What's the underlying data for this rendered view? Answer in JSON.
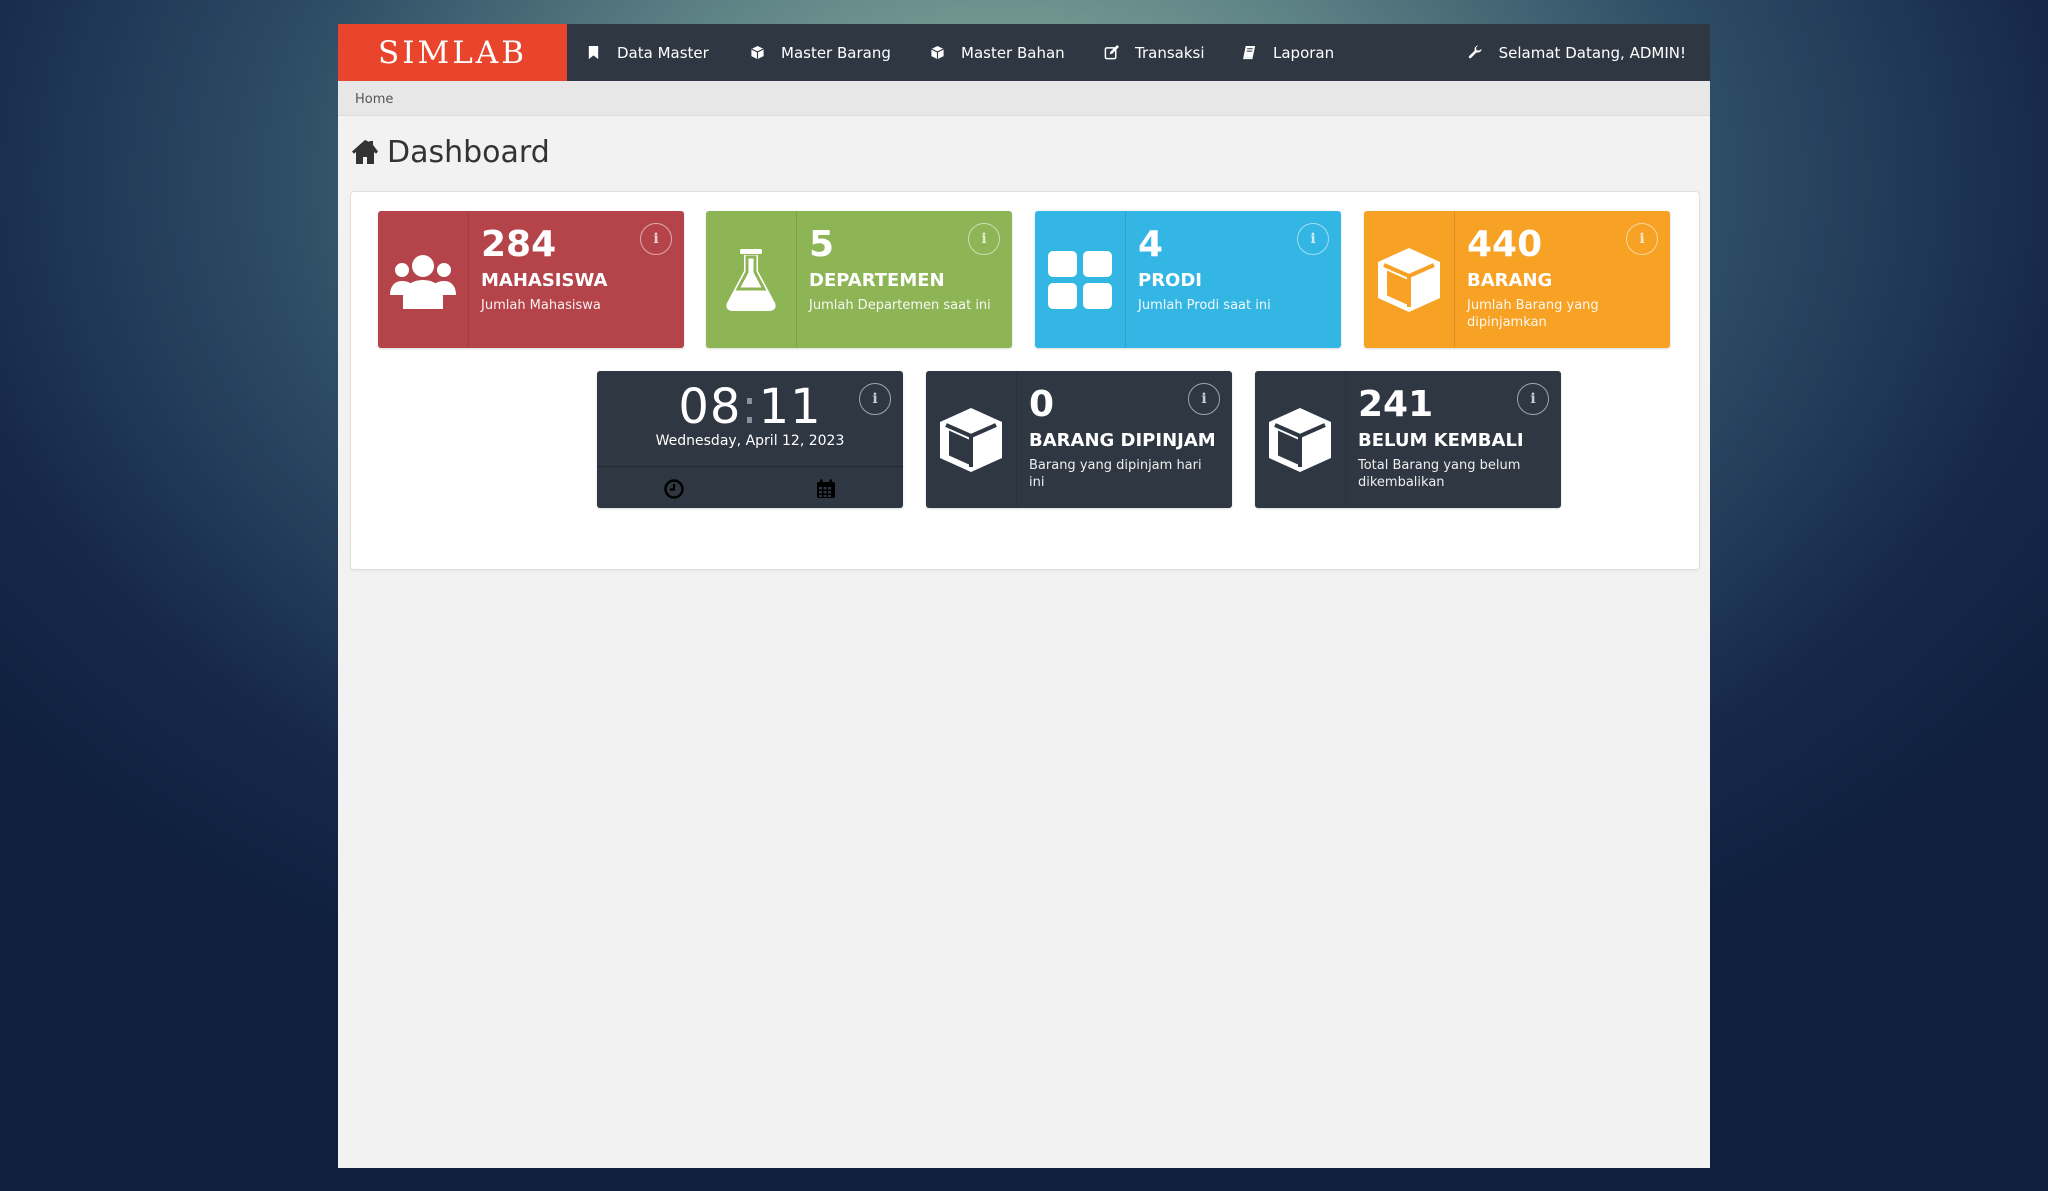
{
  "brand": {
    "name": "SIMLAB"
  },
  "nav": {
    "items": [
      {
        "label": "Data Master",
        "icon": "bookmark-icon"
      },
      {
        "label": "Master Barang",
        "icon": "cube-icon"
      },
      {
        "label": "Master Bahan",
        "icon": "cube-icon"
      },
      {
        "label": "Transaksi",
        "icon": "edit-icon"
      },
      {
        "label": "Laporan",
        "icon": "book-icon"
      }
    ],
    "user": {
      "label": "Selamat Datang, ADMIN!",
      "icon": "wrench-icon"
    }
  },
  "breadcrumb": {
    "home": "Home"
  },
  "page": {
    "title": "Dashboard",
    "icon": "home-icon"
  },
  "tiles": [
    {
      "value": "284",
      "label": "MAHASISWA",
      "desc": "Jumlah Mahasiswa",
      "color": "#b5434a",
      "icon": "users-icon"
    },
    {
      "value": "5",
      "label": "DEPARTEMEN",
      "desc": "Jumlah Departemen saat ini",
      "color": "#8db455",
      "icon": "flask-icon"
    },
    {
      "value": "4",
      "label": "PRODI",
      "desc": "Jumlah Prodi saat ini",
      "color": "#34b6e4",
      "icon": "grid-icon"
    },
    {
      "value": "440",
      "label": "BARANG",
      "desc": "Jumlah Barang yang dipinjamkan",
      "color": "#f7a125",
      "icon": "cube-icon"
    }
  ],
  "clock": {
    "hours": "08",
    "minutes": "11",
    "date": "Wednesday, April 12, 2023",
    "color": "#2f3742"
  },
  "tiles2": [
    {
      "value": "0",
      "label": "BARANG DIPINJAM",
      "desc": "Barang yang dipinjam hari ini",
      "color": "#2f3742",
      "icon": "cube-icon"
    },
    {
      "value": "241",
      "label": "BELUM KEMBALI",
      "desc": "Total Barang yang belum dikembalikan",
      "color": "#2f3742",
      "icon": "cube-icon"
    }
  ],
  "info_glyph": "i"
}
